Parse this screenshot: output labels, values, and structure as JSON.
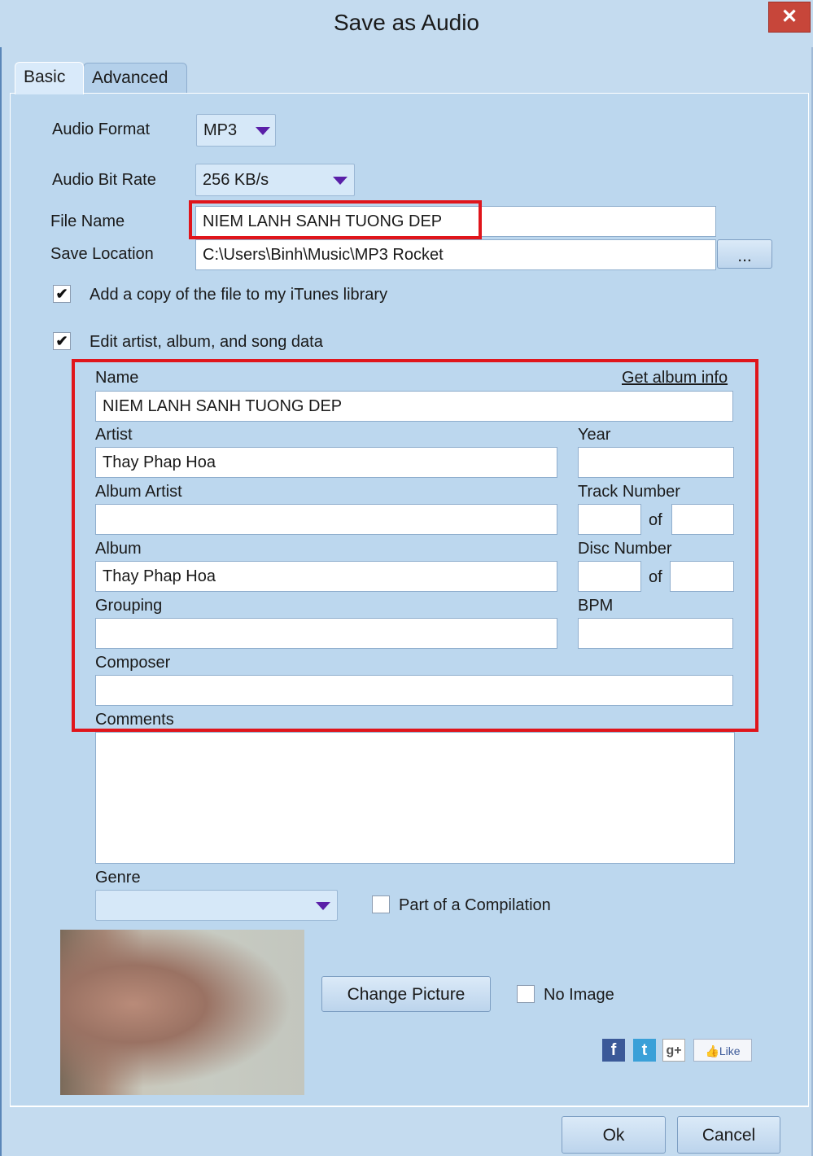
{
  "window": {
    "title": "Save as Audio",
    "close_glyph": "✕"
  },
  "tabs": [
    {
      "label": "Basic",
      "active": true
    },
    {
      "label": "Advanced",
      "active": false
    }
  ],
  "basic": {
    "audio_format": {
      "label": "Audio Format",
      "value": "MP3"
    },
    "bit_rate": {
      "label": "Audio Bit Rate",
      "value": "256 KB/s"
    },
    "file_name": {
      "label": "File Name",
      "value": "NIEM LANH SANH TUONG DEP"
    },
    "save_location": {
      "label": "Save Location",
      "value": "C:\\Users\\Binh\\Music\\MP3 Rocket",
      "browse_label": "..."
    },
    "itunes_copy": {
      "label": "Add a copy of the file to my iTunes library",
      "checked": true
    },
    "edit_tags": {
      "label": "Edit artist, album, and song data",
      "checked": true
    }
  },
  "tags": {
    "name": {
      "label": "Name",
      "value": "NIEM LANH SANH TUONG DEP"
    },
    "get_album_info": "Get album info",
    "artist": {
      "label": "Artist",
      "value": "Thay Phap Hoa"
    },
    "year": {
      "label": "Year",
      "value": ""
    },
    "album_artist": {
      "label": "Album Artist",
      "value": ""
    },
    "track_number": {
      "label": "Track Number",
      "of_label": "of",
      "value": "",
      "of_value": ""
    },
    "album": {
      "label": "Album",
      "value": "Thay Phap Hoa"
    },
    "disc_number": {
      "label": "Disc Number",
      "of_label": "of",
      "value": "",
      "of_value": ""
    },
    "grouping": {
      "label": "Grouping",
      "value": ""
    },
    "bpm": {
      "label": "BPM",
      "value": ""
    },
    "composer": {
      "label": "Composer",
      "value": ""
    },
    "comments": {
      "label": "Comments",
      "value": ""
    },
    "genre": {
      "label": "Genre",
      "value": ""
    },
    "compilation": {
      "label": "Part of a Compilation",
      "checked": false
    }
  },
  "artwork": {
    "change_picture": "Change Picture",
    "no_image": {
      "label": "No Image",
      "checked": false
    }
  },
  "social": {
    "facebook": "f",
    "twitter": "t",
    "google_plus": "g+",
    "like": "Like"
  },
  "footer": {
    "ok": "Ok",
    "cancel": "Cancel"
  },
  "colors": {
    "highlight": "#e0151b",
    "window_bg": "#c4dbef",
    "close": "#c7463a",
    "combo_arrow": "#5a1fa8"
  }
}
